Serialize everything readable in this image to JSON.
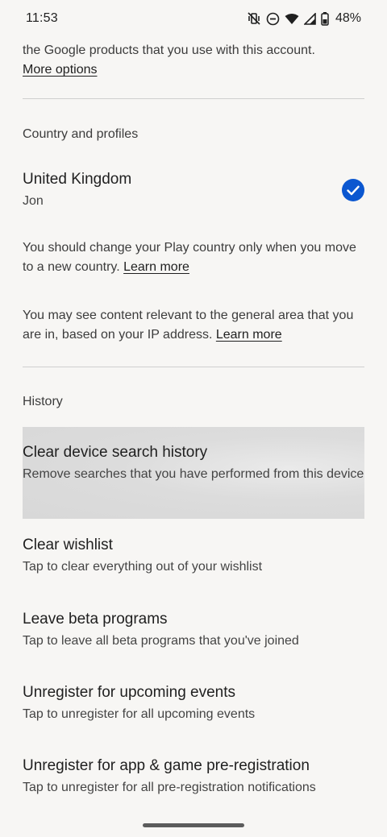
{
  "status": {
    "time": "11:53",
    "battery": "48%"
  },
  "top": {
    "text": "the Google products that you use with this account.",
    "more_options": "More options"
  },
  "country": {
    "section": "Country and profiles",
    "name": "United Kingdom",
    "profile": "Jon",
    "note1": "You should change your Play country only when you move to a new country.",
    "note2": "You may see content relevant to the general area that you are in, based on your IP address.",
    "learn_more": "Learn more"
  },
  "history": {
    "section": "History",
    "items": [
      {
        "title": "Clear device search history",
        "subtitle": "Remove searches that you have performed from this device"
      },
      {
        "title": "Clear wishlist",
        "subtitle": "Tap to clear everything out of your wishlist"
      },
      {
        "title": "Leave beta programs",
        "subtitle": "Tap to leave all beta programs that you've joined"
      },
      {
        "title": "Unregister for upcoming events",
        "subtitle": "Tap to unregister for all upcoming events"
      },
      {
        "title": "Unregister for app & game pre-registration",
        "subtitle": "Tap to unregister for all pre-registration notifications"
      }
    ]
  }
}
